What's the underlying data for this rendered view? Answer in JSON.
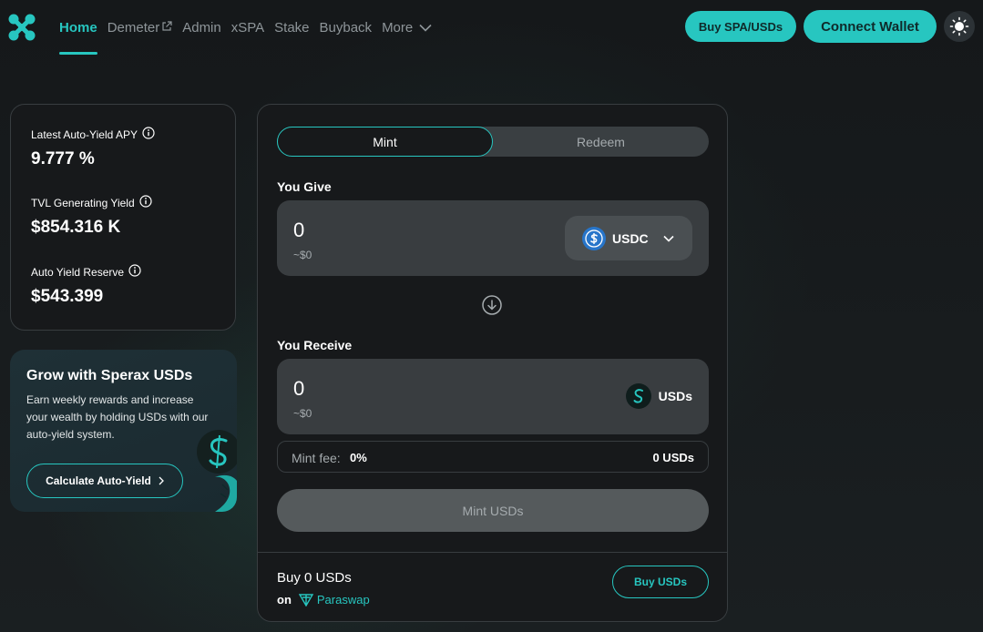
{
  "nav": {
    "items": [
      {
        "label": "Home",
        "active": true
      },
      {
        "label": "Demeter",
        "external": true
      },
      {
        "label": "Admin"
      },
      {
        "label": "xSPA"
      },
      {
        "label": "Stake"
      },
      {
        "label": "Buyback"
      },
      {
        "label": "More"
      }
    ],
    "buy_button": "Buy SPA/USDs",
    "connect_button": "Connect Wallet"
  },
  "stats": {
    "apy_label": "Latest Auto-Yield APY",
    "apy_value": "9.777 %",
    "tvl_label": "TVL Generating Yield",
    "tvl_value": "$854.316 K",
    "reserve_label": "Auto Yield Reserve",
    "reserve_value": "$543.399"
  },
  "promo": {
    "title": "Grow with Sperax USDs",
    "text": "Earn weekly rewards and increase your wealth by holding USDs with our auto-yield system.",
    "button": "Calculate Auto-Yield"
  },
  "swap": {
    "tab_mint": "Mint",
    "tab_redeem": "Redeem",
    "give_label": "You Give",
    "give_amount": "0",
    "give_usd": "~$0",
    "give_token": "USDC",
    "receive_label": "You Receive",
    "receive_amount": "0",
    "receive_usd": "~$0",
    "receive_token": "USDs",
    "fee_label": "Mint fee:",
    "fee_value": "0%",
    "fee_usds": "0 USDs",
    "mint_button": "Mint USDs",
    "buy_text": "Buy 0 USDs",
    "buy_on": "on",
    "buy_via": "Paraswap",
    "buy_button": "Buy USDs"
  },
  "colors": {
    "accent": "#27c6c0",
    "background": "#16191b",
    "card": "#17191b",
    "input": "#393d40",
    "usdc_blue": "#2775ca"
  },
  "icons": [
    "sperax-logo-icon",
    "external-link-icon",
    "chevron-down-icon",
    "sun-icon",
    "info-icon",
    "usdc-icon",
    "usds-icon",
    "arrow-down-circle-icon",
    "chevron-right-icon",
    "paraswap-icon"
  ]
}
